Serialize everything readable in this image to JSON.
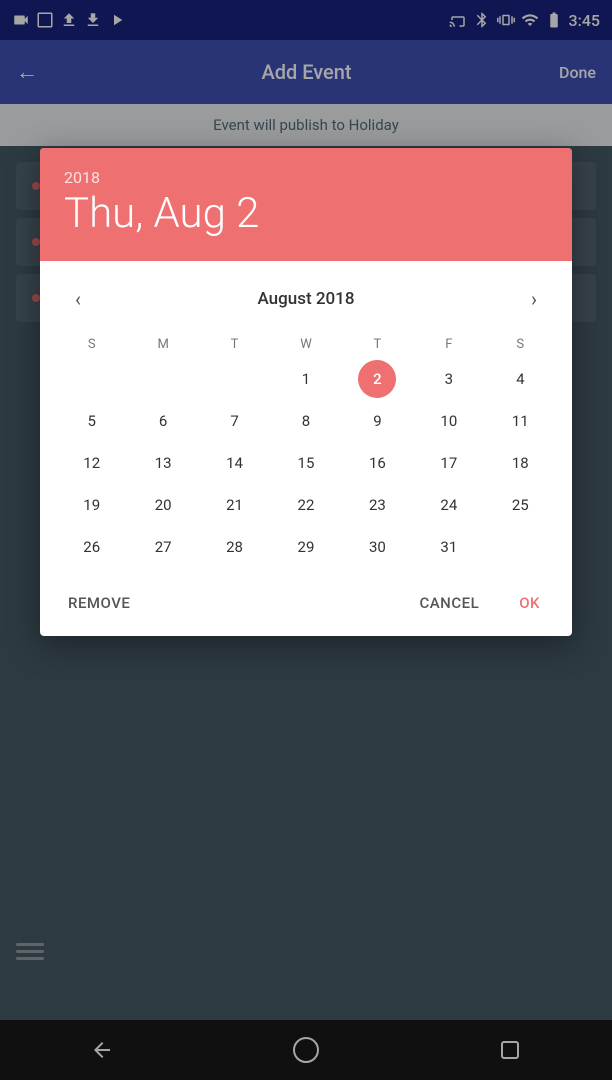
{
  "statusBar": {
    "time": "3:45"
  },
  "appBar": {
    "backArrow": "←",
    "title": "Add Event",
    "done": "Done"
  },
  "publishBanner": {
    "text": "Event will publish to Holiday"
  },
  "dialog": {
    "year": "2018",
    "date": "Thu, Aug 2",
    "header": {
      "background": "#ef7070"
    },
    "calendar": {
      "monthTitle": "August 2018",
      "dayHeaders": [
        "S",
        "M",
        "T",
        "W",
        "T",
        "F",
        "S"
      ],
      "selectedDay": 2,
      "prevArrow": "‹",
      "nextArrow": "›"
    },
    "footer": {
      "remove": "REMOVE",
      "cancel": "CANCEL",
      "ok": "OK"
    }
  },
  "calendarDays": [
    {
      "day": "",
      "col": 1
    },
    {
      "day": "",
      "col": 2
    },
    {
      "day": "",
      "col": 3
    },
    {
      "day": "1",
      "col": 4
    },
    {
      "day": "2",
      "col": 5,
      "selected": true
    },
    {
      "day": "3",
      "col": 6
    },
    {
      "day": "4",
      "col": 7
    },
    {
      "day": "5",
      "col": 1
    },
    {
      "day": "6",
      "col": 2
    },
    {
      "day": "7",
      "col": 3
    },
    {
      "day": "8",
      "col": 4
    },
    {
      "day": "9",
      "col": 5
    },
    {
      "day": "10",
      "col": 6
    },
    {
      "day": "11",
      "col": 7
    },
    {
      "day": "12",
      "col": 1
    },
    {
      "day": "13",
      "col": 2
    },
    {
      "day": "14",
      "col": 3
    },
    {
      "day": "15",
      "col": 4
    },
    {
      "day": "16",
      "col": 5
    },
    {
      "day": "17",
      "col": 6
    },
    {
      "day": "18",
      "col": 7
    },
    {
      "day": "19",
      "col": 1
    },
    {
      "day": "20",
      "col": 2
    },
    {
      "day": "21",
      "col": 3
    },
    {
      "day": "22",
      "col": 4
    },
    {
      "day": "23",
      "col": 5
    },
    {
      "day": "24",
      "col": 6
    },
    {
      "day": "25",
      "col": 7
    },
    {
      "day": "26",
      "col": 1
    },
    {
      "day": "27",
      "col": 2
    },
    {
      "day": "28",
      "col": 3
    },
    {
      "day": "29",
      "col": 4
    },
    {
      "day": "30",
      "col": 5
    },
    {
      "day": "31",
      "col": 6
    },
    {
      "day": "",
      "col": 7
    }
  ]
}
